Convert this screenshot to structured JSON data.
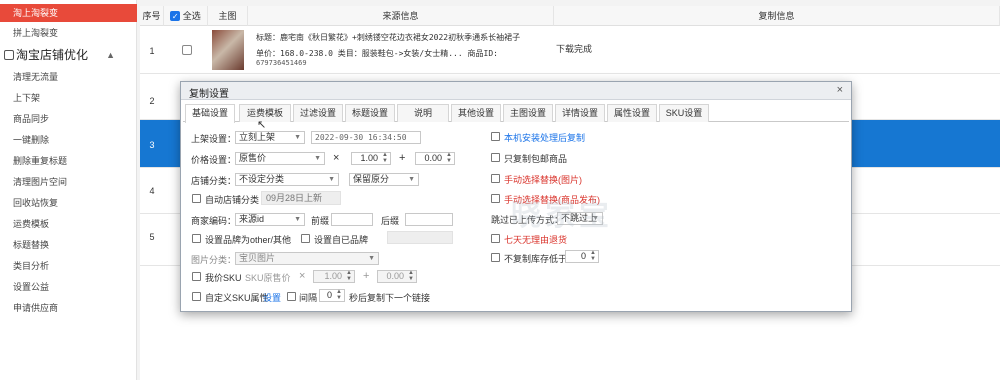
{
  "sidebar": {
    "items_top": [
      "淘上淘裂变",
      "拼上淘裂变"
    ],
    "section_title": "淘宝店铺优化",
    "items": [
      "清理无流量",
      "上下架",
      "商品同步",
      "一键删除",
      "删除重复标题",
      "清理图片空间",
      "回收站恢复",
      "运费模板",
      "标题替换",
      "类目分析",
      "设置公益",
      "申请供应商"
    ]
  },
  "table": {
    "headers": [
      "序号",
      "全选",
      "主图",
      "来源信息",
      "复制信息"
    ],
    "rows": [
      {
        "no": "1",
        "source_line1": "标题：鹿宅南《秋日繁花》+刺绣镂空花边衣裙女2022初秋季通系长袖裙子",
        "source_line2": "单价：168.0-238.0  类目：服装鞋包->女装/女士精...  商品ID:",
        "source_line3": "679736451469",
        "copy_info": "下载完成"
      },
      {
        "no": "2"
      },
      {
        "no": "3"
      },
      {
        "no": "4"
      },
      {
        "no": "5"
      }
    ]
  },
  "dialog": {
    "title": "复制设置",
    "close": "×",
    "tabs": [
      "基础设置",
      "运费模板",
      "过滤设置",
      "标题设置",
      "说明",
      "其他设置",
      "主图设置",
      "详情设置",
      "属性设置",
      "SKU设置"
    ],
    "listing_label": "上架设置：",
    "listing_value": "立刻上架",
    "listing_datetime": "2022-09-30 16:34:50",
    "price_label": "价格设置：",
    "price_value": "原售价",
    "price_multiply": "×",
    "price_factor": "1.00",
    "price_plus": "+",
    "price_add": "0.00",
    "category_label": "店铺分类：",
    "category_value": "不设定分类",
    "category_keep": "保留原分",
    "auto_category_label": "自动店铺分类",
    "auto_category_hint": "09月28日上新",
    "code_label": "商家编码：",
    "code_value": "来源id",
    "prefix_label": "前缀",
    "suffix_label": "后缀",
    "brand_other_label": "设置品牌为other/其他",
    "brand_self_label": "设置自已品牌",
    "image_category_label": "图片分类：",
    "image_category_value": "宝贝图片",
    "sku_price_label": "我价SKU",
    "sku_price_value": "SKU原售价",
    "sku_multiply": "×",
    "sku_factor": "1.00",
    "sku_plus": "+",
    "sku_add": "0.00",
    "custom_sku_label": "自定义SKU属性",
    "custom_sku_link": "设置",
    "interval_label": "间隔",
    "interval_value": "0",
    "interval_suffix": "秒后复制下一个链接",
    "right_options": [
      {
        "text": "本机安装处理后复制",
        "red": false,
        "link": true
      },
      {
        "text": "只复制包邮商品",
        "red": false,
        "link": false
      },
      {
        "text": "手动选择替换(图片)",
        "red": true,
        "link": false
      },
      {
        "text": "手动选择替换(商品发布)",
        "red": true,
        "link": false
      }
    ],
    "skip_label": "跳过已上传方式：",
    "skip_value": "不跳过上",
    "seven_day_label": "七天无理由退货",
    "no_copy_stock_label": "不复制库存低于",
    "no_copy_stock_value": "0"
  },
  "watermark": "晓家宝"
}
